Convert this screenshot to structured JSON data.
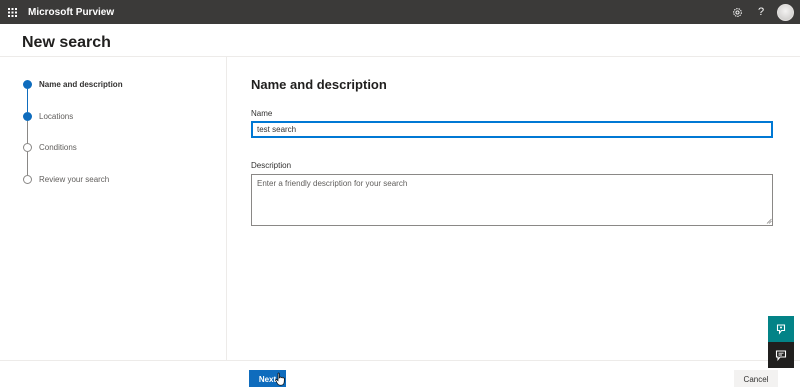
{
  "topbar": {
    "app_title": "Microsoft Purview",
    "help_glyph": "?",
    "icons": {
      "launcher": "app-launcher-icon",
      "settings": "settings-icon",
      "help": "help-icon",
      "avatar": "avatar"
    }
  },
  "header": {
    "page_title": "New search"
  },
  "wizard": {
    "steps": [
      {
        "label": "Name and description",
        "state": "current"
      },
      {
        "label": "Locations",
        "state": "completed"
      },
      {
        "label": "Conditions",
        "state": "pending"
      },
      {
        "label": "Review your search",
        "state": "pending"
      }
    ]
  },
  "form": {
    "section_title": "Name and description",
    "name_label": "Name",
    "name_value": "test search",
    "description_label": "Description",
    "description_value": "",
    "description_placeholder": "Enter a friendly description for your search"
  },
  "footer": {
    "next_label": "Next",
    "cancel_label": "Cancel"
  },
  "side_buttons": {
    "help": "help-chat-icon",
    "feedback": "feedback-icon"
  },
  "colors": {
    "topbar_bg": "#3b3a39",
    "accent": "#0f6cbd",
    "side_help_bg": "#038387",
    "side_feedback_bg": "#201f1e"
  }
}
